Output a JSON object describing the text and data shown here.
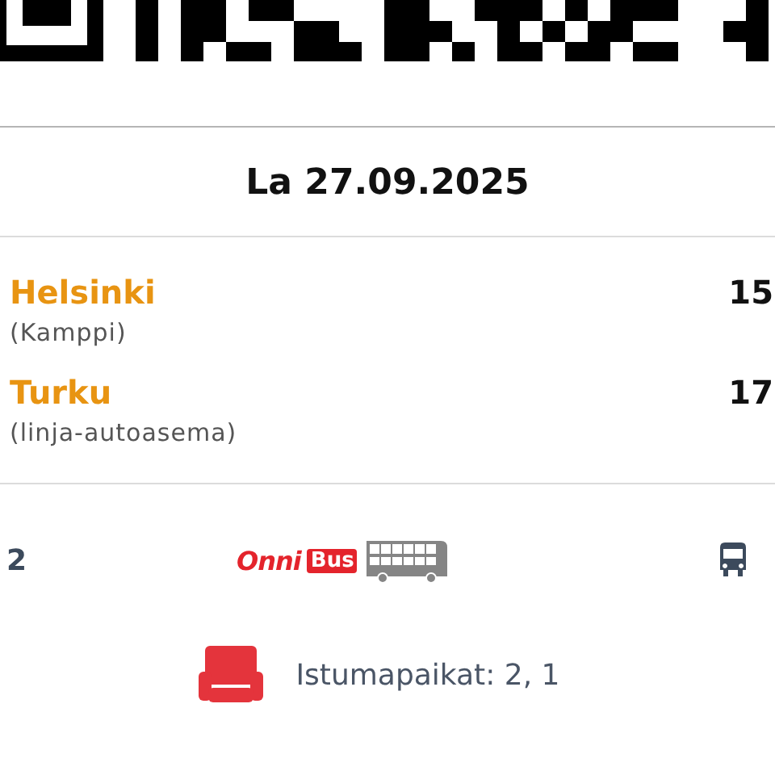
{
  "date": "La 27.09.2025",
  "stops": [
    {
      "city": "Helsinki",
      "place": "(Kamppi)",
      "time": "15"
    },
    {
      "city": "Turku",
      "place": "(linja-autoasema)",
      "time": "17"
    }
  ],
  "bus_row": {
    "number": "2",
    "logo_first": "Onni",
    "logo_second": "Bus"
  },
  "seats": "Istumapaikat: 2, 1"
}
